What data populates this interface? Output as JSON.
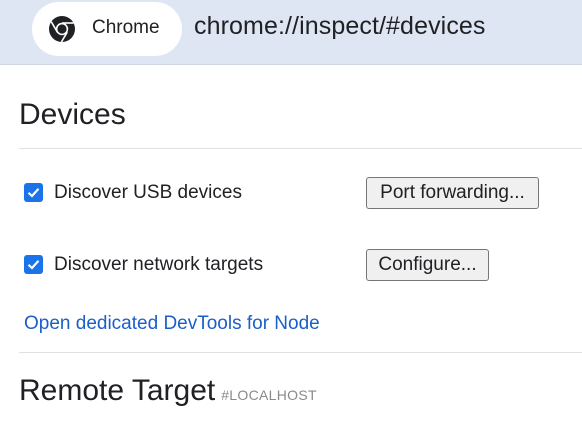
{
  "omnibox": {
    "site_chip_label": "Chrome",
    "url": "chrome://inspect/#devices",
    "site_icon": "chrome-logo-icon"
  },
  "devices": {
    "title": "Devices",
    "usb": {
      "label": "Discover USB devices",
      "checked": true,
      "button_label": "Port forwarding..."
    },
    "network": {
      "label": "Discover network targets",
      "checked": true,
      "button_label": "Configure..."
    },
    "node_link": "Open dedicated DevTools for Node"
  },
  "remote": {
    "title": "Remote Target",
    "tag": "#LOCALHOST"
  },
  "colors": {
    "accent": "#1a73e8",
    "link": "#1a5fc8",
    "omnibox_bg": "#dee6f3"
  }
}
